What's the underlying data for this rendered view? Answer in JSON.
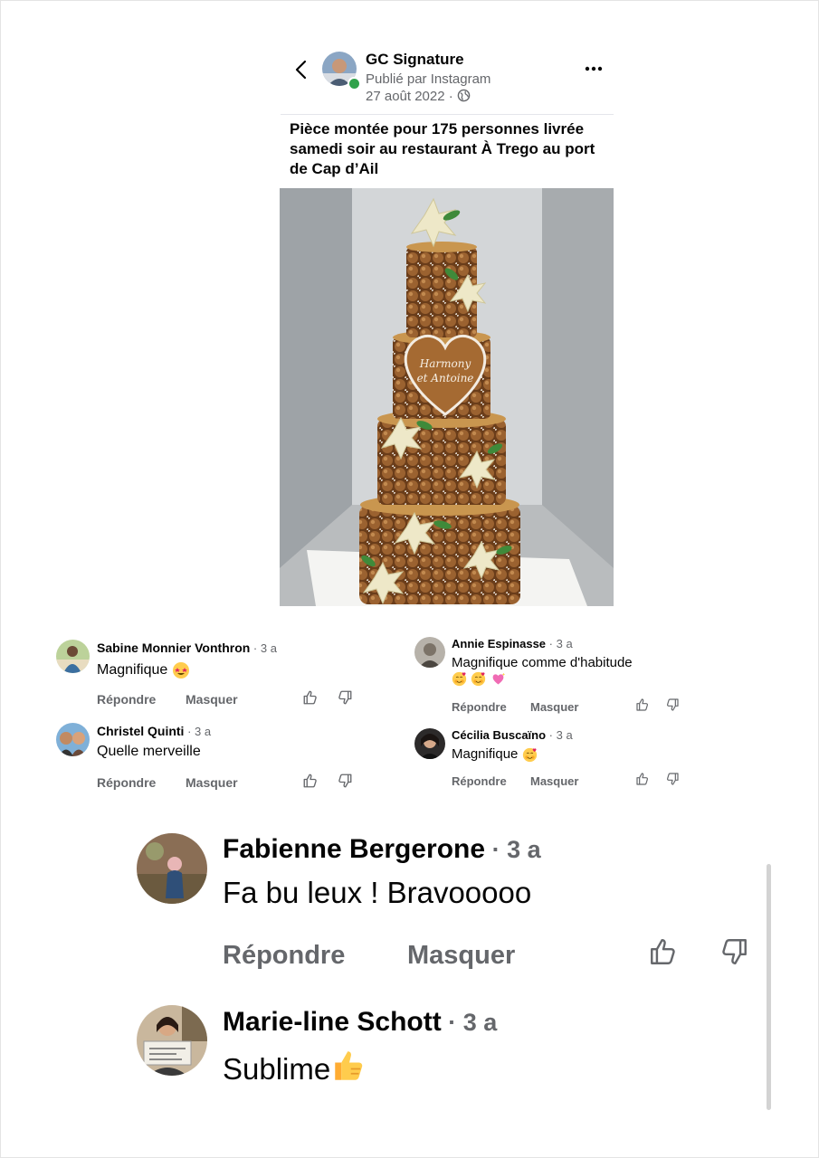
{
  "post": {
    "page_name": "GC Signature",
    "published_via": "Publié par Instagram",
    "date": "27 août 2022",
    "separator": " · ",
    "caption": "Pièce montée pour 175 personnes livrée samedi soir au restaurant À Trego au port de Cap d’Ail",
    "cake_plaque": "Harmony et Antoine"
  },
  "actions": {
    "reply": "Répondre",
    "hide": "Masquer"
  },
  "comments_small": [
    {
      "author": "Sabine Monnier Vonthron",
      "time": " · 3 a",
      "text": "Magnifique"
    },
    {
      "author": "Christel Quinti",
      "time": " · 3 a",
      "text": "Quelle merveille"
    },
    {
      "author": "Annie Espinasse",
      "time": " · 3 a",
      "text": "Magnifique comme d'habitude"
    },
    {
      "author": "Cécilia Buscaïno",
      "time": " · 3 a",
      "text": "Magnifique"
    }
  ],
  "comments_large": [
    {
      "author": "Fabienne Bergerone",
      "time": " · 3 a",
      "text": "Fa bu leux ! Bravooooo"
    },
    {
      "author": "Marie-line Schott",
      "time": " · 3 a",
      "text": "Sublime"
    }
  ],
  "icons": {
    "back": "chevron-left-icon",
    "more": "more-horizontal-icon",
    "globe": "globe-icon",
    "like": "thumbs-up-icon",
    "dislike": "thumbs-down-icon"
  },
  "colors": {
    "secondary_text": "#65676b",
    "online": "#31a24c",
    "cake": "#7a4a21"
  }
}
